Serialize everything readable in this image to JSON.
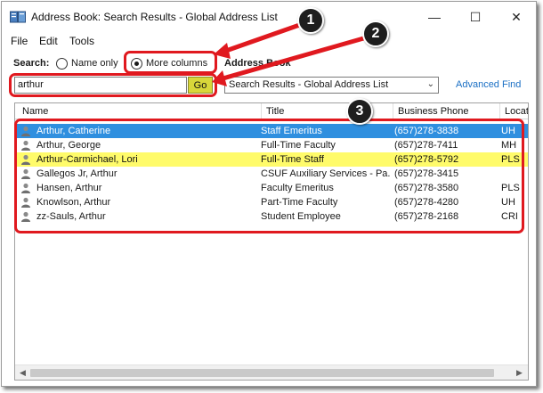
{
  "window": {
    "title": "Address Book: Search Results - Global Address List",
    "controls": {
      "minimize": "—",
      "maximize": "☐",
      "close": "✕"
    }
  },
  "menu": [
    "File",
    "Edit",
    "Tools"
  ],
  "search": {
    "label": "Search:",
    "options": [
      "Name only",
      "More columns"
    ],
    "selected_option": "More columns",
    "query": "arthur",
    "go_label": "Go"
  },
  "address_book": {
    "label": "Address Book",
    "selected": "Search Results - Global Address List",
    "advanced_find": "Advanced Find"
  },
  "columns": [
    "Name",
    "Title",
    "Business Phone",
    "Locat"
  ],
  "rows": [
    {
      "name": "Arthur, Catherine",
      "title": "Staff Emeritus",
      "phone": "(657)278-3838",
      "location": "UH"
    },
    {
      "name": "Arthur, George",
      "title": "Full-Time Faculty",
      "phone": "(657)278-7411",
      "location": "MH"
    },
    {
      "name": "Arthur-Carmichael, Lori",
      "title": "Full-Time Staff",
      "phone": "(657)278-5792",
      "location": "PLS"
    },
    {
      "name": "Gallegos Jr, Arthur",
      "title": "CSUF Auxiliary Services - Pa...",
      "phone": "(657)278-3415",
      "location": ""
    },
    {
      "name": "Hansen, Arthur",
      "title": "Faculty Emeritus",
      "phone": "(657)278-3580",
      "location": "PLS"
    },
    {
      "name": "Knowlson, Arthur",
      "title": "Part-Time Faculty",
      "phone": "(657)278-4280",
      "location": "UH"
    },
    {
      "name": "zz-Sauls, Arthur",
      "title": "Student Employee",
      "phone": "(657)278-2168",
      "location": "CRI"
    }
  ],
  "callouts": [
    "1",
    "2",
    "3"
  ],
  "colors": {
    "selection": "#2f8fdf",
    "highlight": "#fffb6a",
    "go_button": "#d8d63a",
    "annotation_red": "#e0191f",
    "link": "#1a6fc4"
  }
}
